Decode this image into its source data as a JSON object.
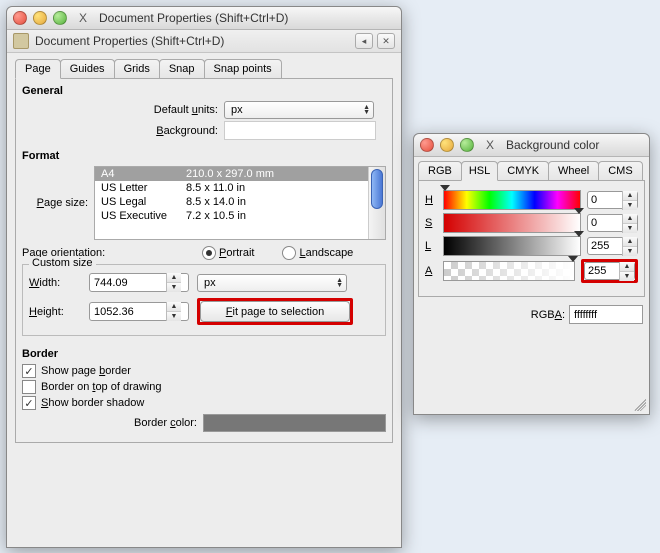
{
  "docprops": {
    "window_title": "Document Properties (Shift+Ctrl+D)",
    "subheader_title": "Document Properties (Shift+Ctrl+D)",
    "tabs": [
      "Page",
      "Guides",
      "Grids",
      "Snap",
      "Snap points"
    ],
    "active_tab": 0,
    "general": {
      "heading": "General",
      "default_units_label": "Default units:",
      "default_units_value": "px",
      "background_label": "Background:"
    },
    "format": {
      "heading": "Format",
      "page_size_label": "Page size:",
      "sizes": [
        {
          "name": "A4",
          "dim": "210.0 x 297.0 mm",
          "selected": true
        },
        {
          "name": "US Letter",
          "dim": "8.5 x 11.0 in",
          "selected": false
        },
        {
          "name": "US Legal",
          "dim": "8.5 x 14.0 in",
          "selected": false
        },
        {
          "name": "US Executive",
          "dim": "7.2 x 10.5 in",
          "selected": false
        }
      ],
      "orientation_label": "Page orientation:",
      "portrait_label": "Portrait",
      "landscape_label": "Landscape",
      "orientation_value": "portrait",
      "custom_legend": "Custom size",
      "width_label": "Width:",
      "width_value": "744.09",
      "height_label": "Height:",
      "height_value": "1052.36",
      "unit_value": "px",
      "fit_button": "Fit page to selection"
    },
    "border": {
      "heading": "Border",
      "show_page_border_label": "Show page border",
      "show_page_border_checked": true,
      "border_on_top_label": "Border on top of drawing",
      "border_on_top_checked": false,
      "show_shadow_label": "Show border shadow",
      "show_shadow_checked": true,
      "border_color_label": "Border color:",
      "border_color": "#777777"
    }
  },
  "bgcolor": {
    "window_title": "Background color",
    "tabs": [
      "RGB",
      "HSL",
      "CMYK",
      "Wheel",
      "CMS"
    ],
    "active_tab": 1,
    "sliders": {
      "h": {
        "label": "H",
        "value": 0,
        "tri_pct": 0
      },
      "s": {
        "label": "S",
        "value": 0,
        "tri_pct": 100
      },
      "l": {
        "label": "L",
        "value": 255,
        "tri_pct": 100
      },
      "a": {
        "label": "A",
        "value": 255,
        "tri_pct": 100
      }
    },
    "rgba_label": "RGBA:",
    "rgba_value": "ffffffff"
  }
}
